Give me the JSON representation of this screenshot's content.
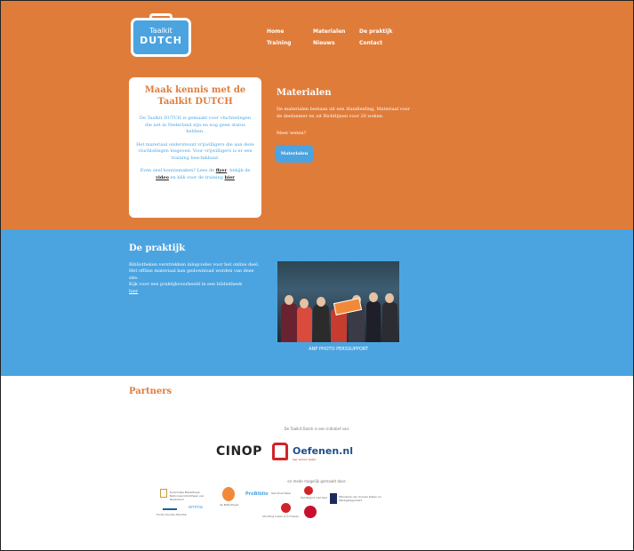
{
  "logo": {
    "line1": "Taalkit",
    "line2": "DUTCH"
  },
  "nav": [
    "Home",
    "Materialen",
    "De praktijk",
    "Training",
    "Nieuws",
    "Contact"
  ],
  "intro": {
    "title": "Maak kennis met de Taalkit DUTCH",
    "p1": "De Taalkit DUTCH is gemaakt voor vluchtelingen die net in Nederland zijn en nog geen status hebben.",
    "p2": "Het materiaal ondersteunt vrijwilligers die aan deze vluchtelingen lesgeven. Voor vrijwilligers is er een training beschikbaar.",
    "p3_text1": "Even snel kennismaken? Lees de ",
    "p3_link1": "flyer",
    "p3_text2": ", bekijk de ",
    "p3_link2": "video",
    "p3_text3": " en klik voor de training ",
    "p3_link3": "hier"
  },
  "materials": {
    "title": "Materialen",
    "text": "De materialen bestaan uit een Handleiding, Materiaal voor de deelnemer en uit Richtlijnen voor 20 weken.",
    "more": "Meer weten?",
    "button": "Materialen"
  },
  "practice": {
    "title": "De praktijk",
    "text": "Bibliotheken verstrekken inlogcodes voor het online deel. Het offline materiaal kan gedownload worden van deze site.",
    "text2": "Kijk voor een praktijkvoorbeeld in een bibliotheek",
    "link": "hier",
    "caption": "ANP PHOTO PERSSUPPORT"
  },
  "partners": {
    "title": "Partners",
    "initiative": "De Taalkit Dutch is een initiatief van:",
    "cinop": "CINOP",
    "oefenen": "Oefenen.nl",
    "oefenen_sub": "leer samen wijzer",
    "supported": "en mede mogelijk gemaakt door:",
    "sponsors": [
      "Koninklijke Bibliotheek Nationale bibliotheek van Nederland",
      "de Bibliotheek",
      "ProBiblio",
      "Taal Doet Meer",
      "Het Begint met Taal",
      "Ministerie van Sociale Zaken en Werkgelegenheid",
      "emma",
      "Stichting Lezen & Schrijven",
      "Fonds Sociale Alliantie"
    ]
  },
  "colors": {
    "orange": "#e07c3a",
    "blue": "#4ba4e0"
  }
}
